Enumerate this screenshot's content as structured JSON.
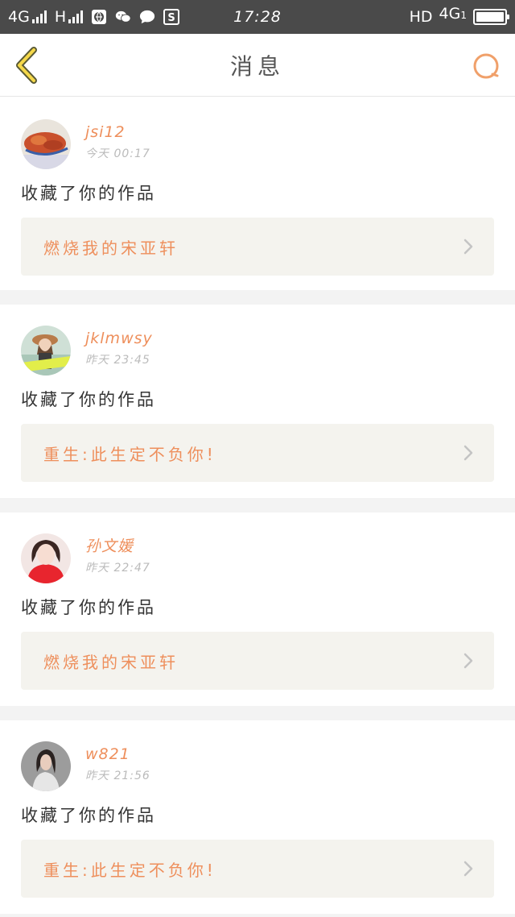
{
  "status_bar": {
    "network_left": "4G",
    "network_h": "H",
    "time": "17:28",
    "hd_label": "HD",
    "network_right": "4G",
    "network_right_sub": "1",
    "icons": [
      "globe-icon",
      "wechat-icon",
      "chat-bubble-icon",
      "s-app-icon",
      "battery-icon"
    ]
  },
  "navbar": {
    "title": "消息",
    "back_icon": "chevron-left-icon",
    "search_icon": "search-icon",
    "accent": "#ee8f5c"
  },
  "messages": [
    {
      "username": "jsi12",
      "time": "今天 00:17",
      "action": "收藏了你的作品",
      "work_title": "燃烧我的宋亚轩",
      "avatar": "avatar-food"
    },
    {
      "username": "jklmwsy",
      "time": "昨天 23:45",
      "action": "收藏了你的作品",
      "work_title": "重生:此生定不负你!",
      "avatar": "avatar-girl-hat"
    },
    {
      "username": "孙文媛",
      "time": "昨天 22:47",
      "action": "收藏了你的作品",
      "work_title": "燃烧我的宋亚轩",
      "avatar": "avatar-girl-red"
    },
    {
      "username": "w821",
      "time": "昨天 21:56",
      "action": "收藏了你的作品",
      "work_title": "重生:此生定不负你!",
      "avatar": "avatar-woman"
    }
  ]
}
